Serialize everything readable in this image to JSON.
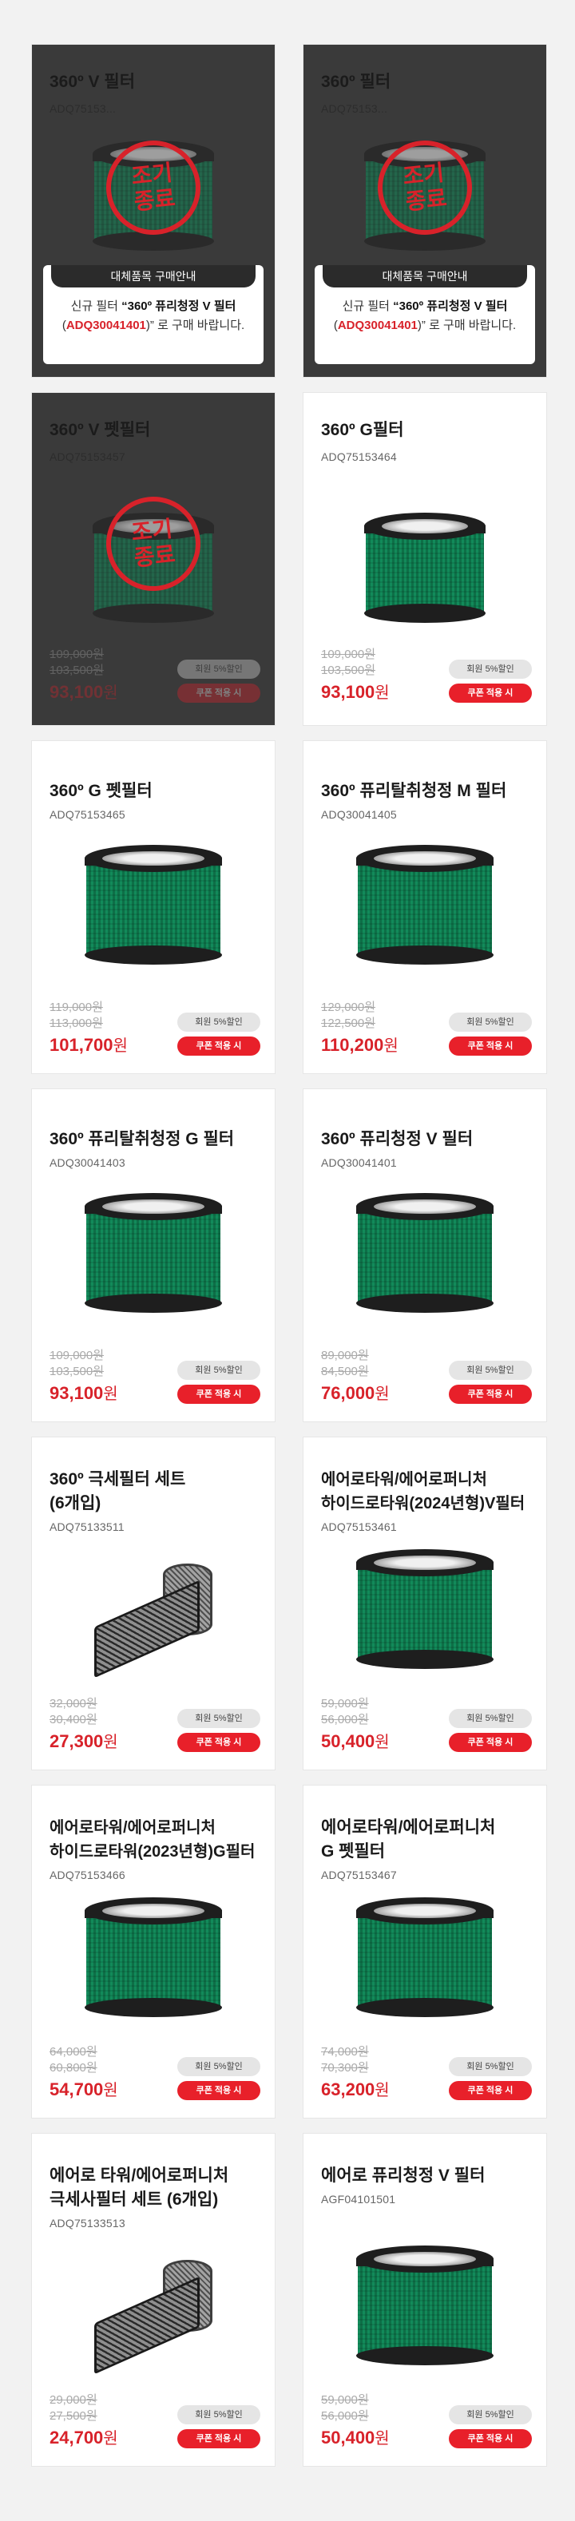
{
  "products": [
    {
      "title": "360º V 필터",
      "code": "ADQ75153...",
      "status": "discontinued",
      "stamp": [
        "조기",
        "종료"
      ],
      "replacement": {
        "heading": "대체품목 구매안내",
        "msg_prefix": "신규 필터 ",
        "msg_name": "“360º 퓨리청정 V 필터",
        "msg_code": "ADQ30041401",
        "msg_suffix": ")” 로 구매 바랍니다."
      }
    },
    {
      "title": "360º 필터",
      "code": "ADQ75153...",
      "status": "discontinued",
      "stamp": [
        "조기",
        "종료"
      ],
      "replacement": {
        "heading": "대체품목 구매안내",
        "msg_prefix": "신규 필터 ",
        "msg_name": "“360º 퓨리청정 V 필터",
        "msg_code": "ADQ30041401",
        "msg_suffix": ")” 로 구매 바랍니다."
      }
    },
    {
      "title": "360º V 펫필터",
      "code": "ADQ75153457",
      "status": "discontinued",
      "stamp": [
        "조기",
        "종료"
      ],
      "list_price": "109,000원",
      "member_price": "103,500원",
      "sale_price": "93,100",
      "currency": "원",
      "badge_member": "회원 5%할인",
      "badge_coupon": "쿠폰 적용 시"
    },
    {
      "title": "360º G필터",
      "code": "ADQ75153464",
      "list_price": "109,000원",
      "member_price": "103,500원",
      "sale_price": "93,100",
      "currency": "원",
      "badge_member": "회원 5%할인",
      "badge_coupon": "쿠폰 적용 시"
    },
    {
      "title": "360º G 펫필터",
      "code": "ADQ75153465",
      "list_price": "119,000원",
      "member_price": "113,000원",
      "sale_price": "101,700",
      "currency": "원",
      "badge_member": "회원 5%할인",
      "badge_coupon": "쿠폰 적용 시"
    },
    {
      "title": "360º 퓨리탈취청정 M 필터",
      "code": "ADQ30041405",
      "list_price": "129,000원",
      "member_price": "122,500원",
      "sale_price": "110,200",
      "currency": "원",
      "badge_member": "회원 5%할인",
      "badge_coupon": "쿠폰 적용 시"
    },
    {
      "title": "360º 퓨리탈취청정 G 필터",
      "code": "ADQ30041403",
      "list_price": "109,000원",
      "member_price": "103,500원",
      "sale_price": "93,100",
      "currency": "원",
      "badge_member": "회원 5%할인",
      "badge_coupon": "쿠폰 적용 시"
    },
    {
      "title": "360º 퓨리청정 V 필터",
      "code": "ADQ30041401",
      "list_price": "89,000원",
      "member_price": "84,500원",
      "sale_price": "76,000",
      "currency": "원",
      "badge_member": "회원 5%할인",
      "badge_coupon": "쿠폰 적용 시"
    },
    {
      "title": "360º 극세필터 세트\n(6개입)",
      "code": "ADQ75133511",
      "list_price": "32,000원",
      "member_price": "30,400원",
      "sale_price": "27,300",
      "currency": "원",
      "badge_member": "회원 5%할인",
      "badge_coupon": "쿠폰 적용 시"
    },
    {
      "title": "에어로타워/에어로퍼니처\n하이드로타워(2024년형)V필터",
      "code": "ADQ75153461",
      "list_price": "59,000원",
      "member_price": "56,000원",
      "sale_price": "50,400",
      "currency": "원",
      "badge_member": "회원 5%할인",
      "badge_coupon": "쿠폰 적용 시"
    },
    {
      "title": "에어로타워/에어로퍼니처\n하이드로타워(2023년형)G필터",
      "code": "ADQ75153466",
      "list_price": "64,000원",
      "member_price": "60,800원",
      "sale_price": "54,700",
      "currency": "원",
      "badge_member": "회원 5%할인",
      "badge_coupon": "쿠폰 적용 시"
    },
    {
      "title": "에어로타워/에어로퍼니처\nG 펫필터",
      "code": "ADQ75153467",
      "list_price": "74,000원",
      "member_price": "70,300원",
      "sale_price": "63,200",
      "currency": "원",
      "badge_member": "회원 5%할인",
      "badge_coupon": "쿠폰 적용 시"
    },
    {
      "title": "에어로 타워/에어로퍼니처\n극세사필터 세트 (6개입)",
      "code": "ADQ75133513",
      "list_price": "29,000원",
      "member_price": "27,500원",
      "sale_price": "24,700",
      "currency": "원",
      "badge_member": "회원 5%할인",
      "badge_coupon": "쿠폰 적용 시"
    },
    {
      "title": "에어로 퓨리청정 V 필터",
      "code": "AGF04101501",
      "list_price": "59,000원",
      "member_price": "56,000원",
      "sale_price": "50,400",
      "currency": "원",
      "badge_member": "회원 5%할인",
      "badge_coupon": "쿠폰 적용 시"
    }
  ],
  "colors": {
    "sale_red": "#d8222a",
    "coupon_red": "#e8202a",
    "dark_card": "#3a3a3a"
  }
}
